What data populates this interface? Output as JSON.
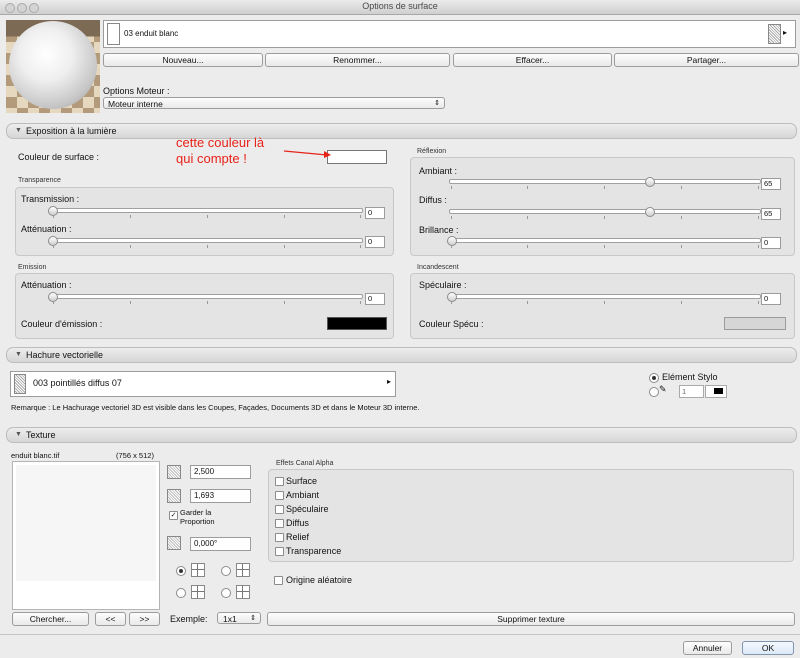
{
  "window": {
    "title": "Options de surface"
  },
  "material": {
    "name": "03 enduit blanc"
  },
  "buttons": {
    "new": "Nouveau...",
    "rename": "Renommer...",
    "delete": "Effacer...",
    "share": "Partager..."
  },
  "engine": {
    "label": "Options Moteur :",
    "value": "Moteur interne"
  },
  "exposure": {
    "title": "Exposition à la lumière",
    "surface_color_label": "Couleur de surface :",
    "annotation": "cette couleur là\nqui compte !",
    "transparency": {
      "title": "Transparence",
      "transmission_label": "Transmission :",
      "transmission_value": "0",
      "attenuation_label": "Atténuation :",
      "attenuation_value": "0"
    },
    "reflection": {
      "title": "Réflexion",
      "ambient_label": "Ambiant :",
      "ambient_value": "65",
      "diffuse_label": "Diffus :",
      "diffuse_value": "65",
      "shine_label": "Brillance :",
      "shine_value": "0"
    },
    "emission": {
      "title": "Emission",
      "attenuation_label": "Atténuation :",
      "attenuation_value": "0",
      "color_label": "Couleur d'émission :"
    },
    "incandescent": {
      "title": "Incandescent",
      "specular_label": "Spéculaire :",
      "specular_value": "0",
      "color_label": "Couleur Spécu :"
    }
  },
  "colors": {
    "annotation_red": "#e8231a",
    "emission_color": "#000000",
    "specular_color": "#d6d6d6"
  },
  "hatch": {
    "title": "Hachure vectorielle",
    "pattern": "003 pointillés diffus 07",
    "pen_option": "Elément Stylo",
    "pen_number": "1",
    "note": "Remarque : Le Hachurage vectoriel 3D est visible dans les Coupes, Façades, Documents 3D et dans le Moteur 3D interne."
  },
  "texture": {
    "title": "Texture",
    "file": "enduit blanc.tif",
    "dims": "(756 x 512)",
    "width": "2,500",
    "height": "1,693",
    "keep_proportion": "Garder la\nProportion",
    "angle": "0,000°",
    "alpha_title": "Effets Canal Alpha",
    "alpha_options": [
      "Surface",
      "Ambiant",
      "Spéculaire",
      "Diffus",
      "Relief",
      "Transparence"
    ],
    "random_origin": "Origine aléatoire",
    "search_button": "Chercher...",
    "prev": "<<",
    "next": ">>",
    "example_label": "Exemple:",
    "example_value": "1x1",
    "remove_button": "Supprimer texture"
  },
  "footer": {
    "cancel": "Annuler",
    "ok": "OK"
  }
}
